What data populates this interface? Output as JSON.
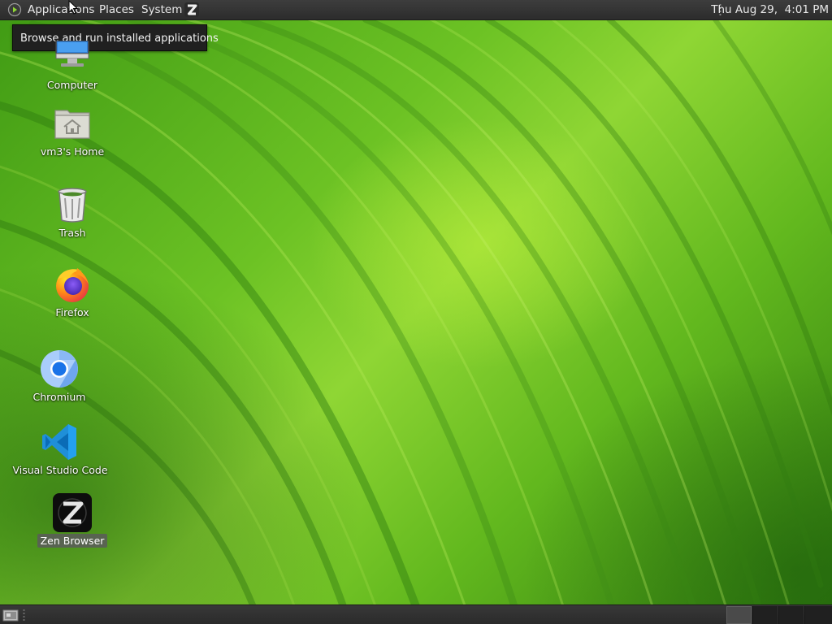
{
  "top_panel": {
    "menus": {
      "applications": "Applications",
      "places": "Places",
      "system": "System"
    },
    "launcher_icon": "zen-browser-icon",
    "clock": "Thu Aug 29,  4:01 PM"
  },
  "tooltip": {
    "text": "Browse and run installed applications"
  },
  "desktop": {
    "icons": [
      {
        "label": "Computer",
        "icon": "computer-icon"
      },
      {
        "label": "vm3's Home",
        "icon": "home-folder-icon"
      },
      {
        "label": "Trash",
        "icon": "trash-icon"
      },
      {
        "label": "Firefox",
        "icon": "firefox-icon"
      },
      {
        "label": "Chromium",
        "icon": "chromium-icon"
      },
      {
        "label": "Visual Studio Code",
        "icon": "vscode-icon"
      },
      {
        "label": "Zen Browser",
        "icon": "zen-browser-icon",
        "selected": true
      }
    ],
    "wallpaper": "green leaf"
  },
  "bottom_panel": {
    "show_desktop_icon": "show-desktop-icon",
    "workspaces": 4,
    "active_workspace": 1
  },
  "colors": {
    "panel": "#2c2c2c",
    "panel_text": "#e9e9e9",
    "tooltip_bg": "#202020",
    "wallpaper_green": "#6cc224"
  }
}
